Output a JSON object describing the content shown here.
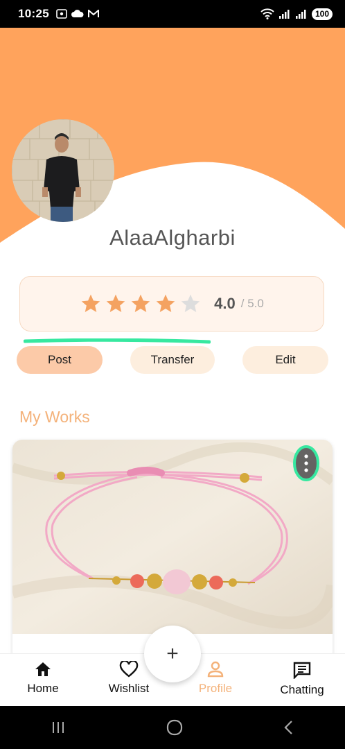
{
  "status_bar": {
    "time": "10:25",
    "battery": "100"
  },
  "profile": {
    "username": "AlaaAlgharbi",
    "rating": {
      "value_label": "4.0",
      "max_label": "/ 5.0",
      "stars_filled": 4,
      "stars_total": 5
    }
  },
  "actions": {
    "post_label": "Post",
    "transfer_label": "Transfer",
    "edit_label": "Edit"
  },
  "works": {
    "title": "My Works"
  },
  "bottom_nav": {
    "items": [
      {
        "label": "Home",
        "icon": "home-icon"
      },
      {
        "label": "Wishlist",
        "icon": "heart-icon"
      },
      {
        "label": "Profile",
        "icon": "person-icon"
      },
      {
        "label": "Chatting",
        "icon": "chat-icon"
      }
    ],
    "active_index": 2,
    "fab_symbol": "+"
  },
  "colors": {
    "accent": "#f4b27a",
    "header": "#ffa35c",
    "highlight": "#37e8a0"
  }
}
